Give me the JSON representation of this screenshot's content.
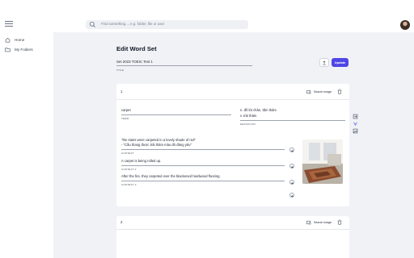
{
  "header": {
    "search_placeholder": "Find something..., e.g. folder, file or user"
  },
  "sidebar": {
    "items": [
      {
        "label": "Home",
        "icon": "home-icon"
      },
      {
        "label": "My Folders",
        "icon": "folder-icon"
      }
    ]
  },
  "page": {
    "title": "Edit Word Set",
    "set_title_value": "Set 2023 TOEIC Test 1",
    "set_title_label": "TITLE",
    "update_label": "Update",
    "accent_color": "#4f46e5"
  },
  "cards": [
    {
      "number": "1",
      "search_image_label": "Search image",
      "term_value": "carpet",
      "term_label": "TERM",
      "definition_lines": [
        "n. đồ lót chân, tấm thảm",
        "v. trải thảm"
      ],
      "definition_label": "DEFINITION",
      "contexts": [
        {
          "lines": [
            "\"the stairs were carpeted in a lovely shade of red\"",
            "- \"Cầu thang được trải thảm màu đỏ đáng yêu\""
          ],
          "label": "CONTEXT"
        },
        {
          "lines": [
            "A carpet is being rolled up."
          ],
          "label": "CONTEXT 2"
        },
        {
          "lines": [
            "After the fire, they carpeted over the blackened hardwood flooring."
          ],
          "label": "CONTEXT 3"
        }
      ]
    },
    {
      "number": "2",
      "search_image_label": "Search image"
    }
  ]
}
